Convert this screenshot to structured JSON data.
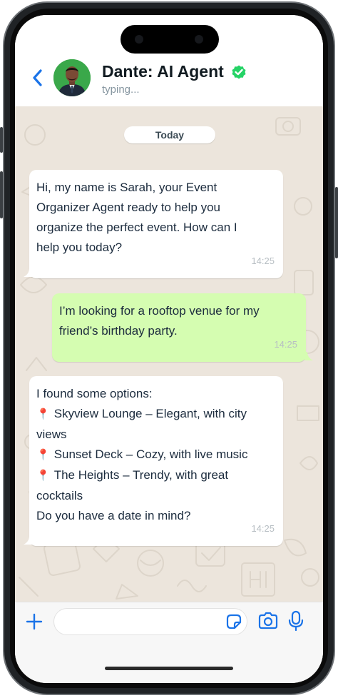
{
  "header": {
    "contact_name": "Dante: AI Agent",
    "status": "typing..."
  },
  "chat": {
    "date_divider": "Today",
    "messages": [
      {
        "direction": "incoming",
        "lines": [
          "Hi, my name is Sarah, your Event",
          "Organizer Agent ready to help you",
          "organize the perfect event. How can I",
          "help you today?"
        ],
        "time": "14:25"
      },
      {
        "direction": "outgoing",
        "lines": [
          "I’m looking for a rooftop venue for my",
          "friend’s birthday party."
        ],
        "time": "14:25"
      },
      {
        "direction": "incoming",
        "intro": "I found some options:",
        "options": [
          {
            "icon": "pushpin-icon",
            "text": "Skyview Lounge – Elegant, with city",
            "wrap": "views"
          },
          {
            "icon": "pushpin-icon",
            "text": "Sunset Deck – Cozy, with live music",
            "wrap": ""
          },
          {
            "icon": "pushpin-icon",
            "text": "The Heights – Trendy, with great",
            "wrap": "cocktails"
          }
        ],
        "outro": "Do you have a date in mind?",
        "time": "14:25"
      }
    ]
  },
  "composer": {
    "placeholder": ""
  },
  "colors": {
    "accent_blue": "#1a73e8",
    "verified_green": "#25d366",
    "outgoing_bubble": "#d5fdb1",
    "incoming_bubble": "#ffffff",
    "chat_background": "#ece5dc",
    "pin_red": "#d6353f"
  }
}
